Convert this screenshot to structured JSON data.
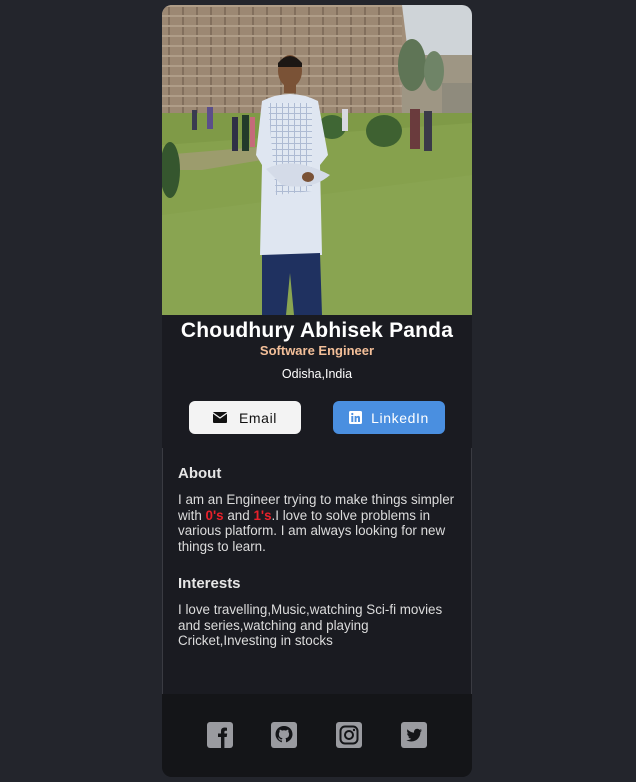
{
  "profile": {
    "name": "Choudhury Abhisek Panda",
    "role": "Software Engineer",
    "location": "Odisha,India"
  },
  "buttons": {
    "email_label": "Email",
    "linkedin_label": "LinkedIn"
  },
  "about": {
    "heading": "About",
    "text_1": "I am an Engineer trying to make things simpler with ",
    "highlight_1": "0's",
    "text_2": " and ",
    "highlight_2": "1's",
    "text_3": ".I love to solve problems in various platform. I am always looking for new things to learn."
  },
  "interests": {
    "heading": "Interests",
    "text": "I love travelling,Music,watching Sci-fi movies and series,watching and playing Cricket,Investing in stocks"
  },
  "footer": {
    "icons": [
      "facebook-icon",
      "github-icon",
      "instagram-icon",
      "twitter-icon"
    ]
  },
  "colors": {
    "background": "#23252c",
    "card": "#1a1b21",
    "role_accent": "#f3bf99",
    "highlight": "#e8212b",
    "linkedin_button": "#4a8fe0",
    "email_button": "#f3f3f3",
    "footer": "#141518",
    "social_icon": "#9a9ba0"
  }
}
